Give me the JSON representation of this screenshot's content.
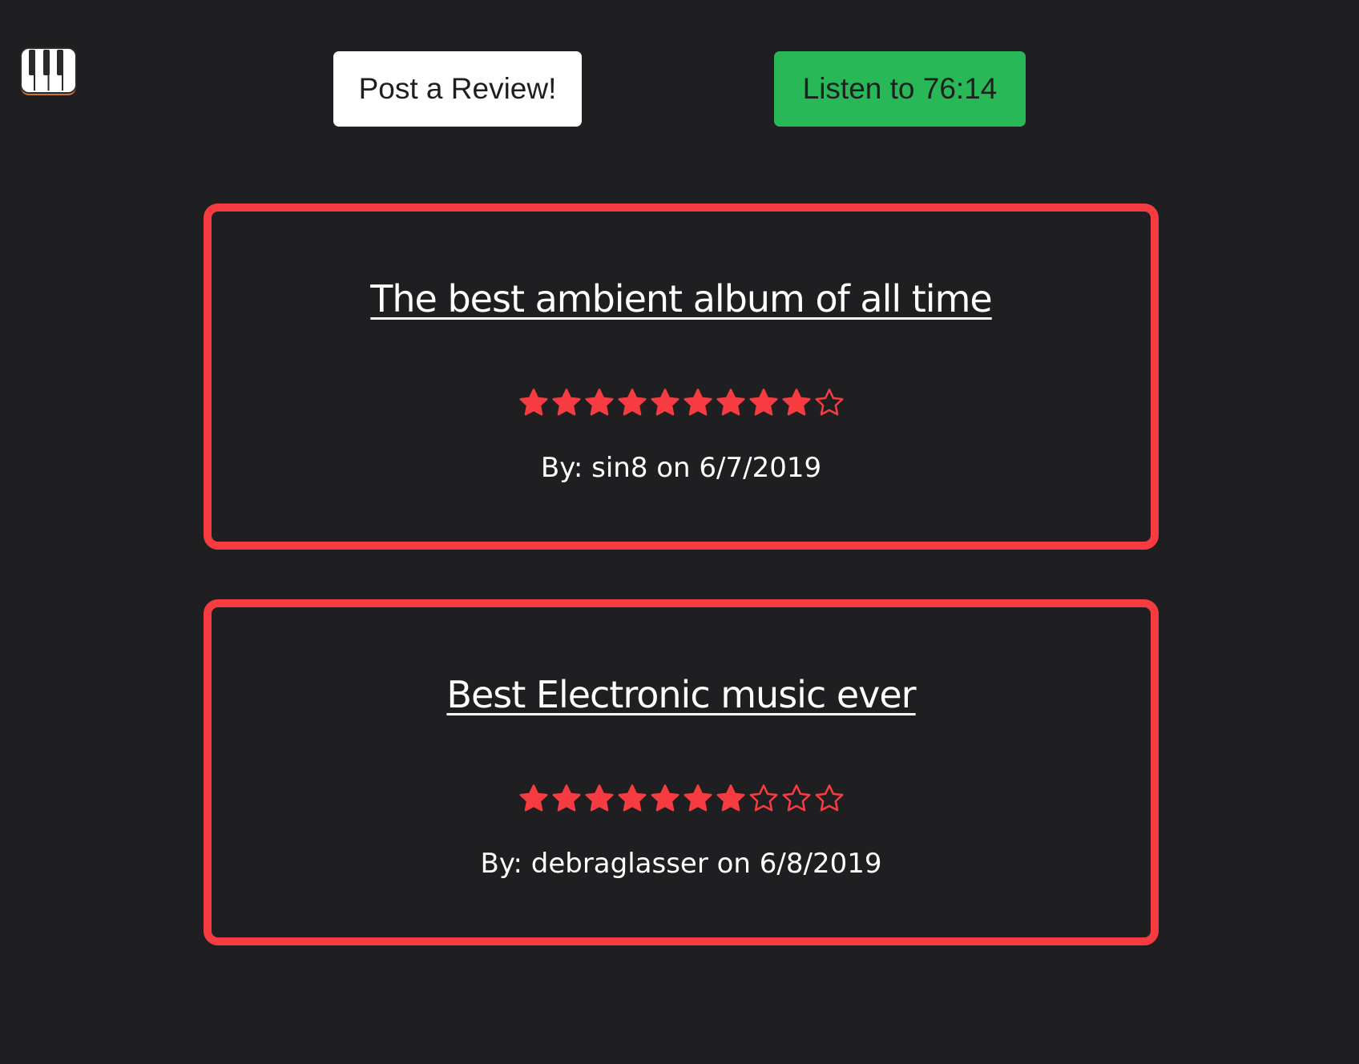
{
  "logo": {
    "icon": "piano-keys-icon"
  },
  "header": {
    "post_review_label": "Post a Review!",
    "listen_label": "Listen to 76:14"
  },
  "colors": {
    "background": "#1f1e21",
    "accent_red": "#f63c41",
    "listen_green": "#28b857",
    "text": "#ffffff"
  },
  "reviews": [
    {
      "title": "The best ambient album of all time",
      "rating": 9,
      "max_rating": 10,
      "byline": "By: sin8 on 6/7/2019"
    },
    {
      "title": "Best Electronic music ever",
      "rating": 7,
      "max_rating": 10,
      "byline": "By: debraglasser on 6/8/2019"
    }
  ]
}
